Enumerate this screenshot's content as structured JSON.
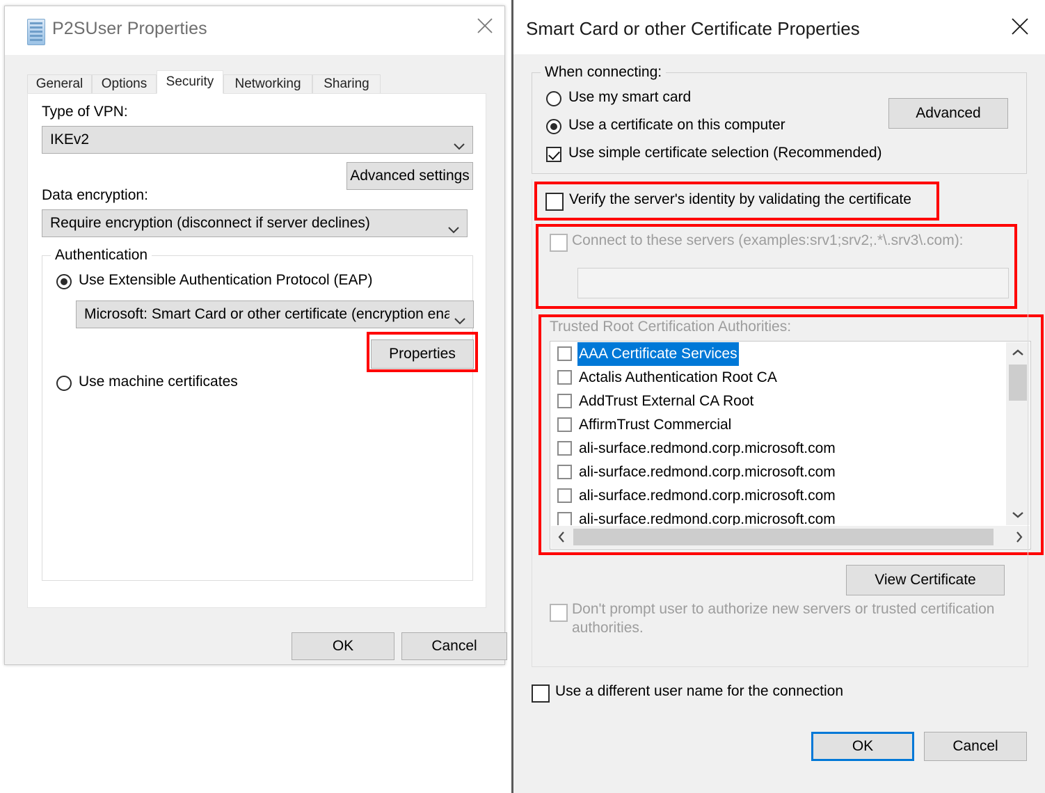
{
  "left_dialog": {
    "title": "P2SUser Properties",
    "icon": "server-icon",
    "close_label": "✕",
    "tabs": [
      {
        "label": "General",
        "active": false
      },
      {
        "label": "Options",
        "active": false
      },
      {
        "label": "Security",
        "active": true
      },
      {
        "label": "Networking",
        "active": false
      },
      {
        "label": "Sharing",
        "active": false
      }
    ],
    "vpn_type_label": "Type of VPN:",
    "vpn_type_value": "IKEv2",
    "advanced_settings_label": "Advanced settings",
    "data_encryption_label": "Data encryption:",
    "data_encryption_value": "Require encryption (disconnect if server declines)",
    "authentication_group_title": "Authentication",
    "eap_radio_label": "Use Extensible Authentication Protocol (EAP)",
    "eap_radio_selected": true,
    "eap_method_value": "Microsoft: Smart Card or other certificate (encryption ena",
    "properties_button_label": "Properties",
    "machine_certs_radio_label": "Use machine certificates",
    "machine_certs_selected": false,
    "ok_label": "OK",
    "cancel_label": "Cancel"
  },
  "right_dialog": {
    "title": "Smart Card or other Certificate Properties",
    "close_label": "✕",
    "when_connecting_group_title": "When connecting:",
    "use_smart_card_label": "Use my smart card",
    "use_smart_card_selected": false,
    "use_certificate_label": "Use a certificate on this computer",
    "use_certificate_selected": true,
    "simple_selection_label": "Use simple certificate selection (Recommended)",
    "simple_selection_checked": true,
    "advanced_button_label": "Advanced",
    "verify_server_label": "Verify the server's identity by validating the certificate",
    "verify_server_checked": false,
    "connect_servers_label": "Connect to these servers (examples:srv1;srv2;.*\\.srv3\\.com):",
    "connect_servers_checked": false,
    "connect_servers_value": "",
    "trusted_roots_label": "Trusted Root Certification Authorities:",
    "trusted_roots": [
      {
        "label": "AAA Certificate Services",
        "checked": false,
        "selected": true
      },
      {
        "label": "Actalis Authentication Root CA",
        "checked": false,
        "selected": false
      },
      {
        "label": "AddTrust External CA Root",
        "checked": false,
        "selected": false
      },
      {
        "label": "AffirmTrust Commercial",
        "checked": false,
        "selected": false
      },
      {
        "label": "ali-surface.redmond.corp.microsoft.com",
        "checked": false,
        "selected": false
      },
      {
        "label": "ali-surface.redmond.corp.microsoft.com",
        "checked": false,
        "selected": false
      },
      {
        "label": "ali-surface.redmond.corp.microsoft.com",
        "checked": false,
        "selected": false
      },
      {
        "label": "ali-surface.redmond.corp.microsoft.com",
        "checked": false,
        "selected": false
      }
    ],
    "view_certificate_label": "View Certificate",
    "dont_prompt_label": "Don't prompt user to authorize new servers or trusted certification authorities.",
    "dont_prompt_checked": false,
    "different_username_label": "Use a different user name for the connection",
    "different_username_checked": false,
    "ok_label": "OK",
    "cancel_label": "Cancel"
  },
  "annotations": {
    "highlight_color": "#ff0000",
    "focus_color": "#0078d7",
    "selection_color": "#0078d7"
  }
}
